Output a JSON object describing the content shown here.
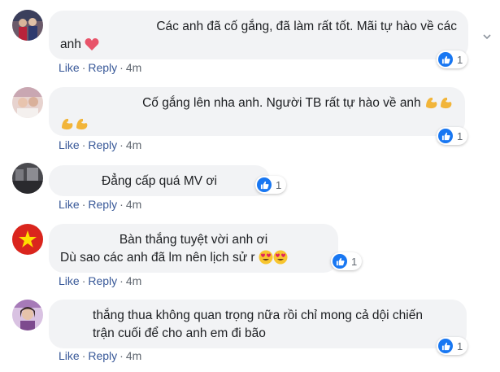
{
  "comments": [
    {
      "lines": [
        "Các anh đã cố gắng, đã làm rất tốt. Mãi tự hào về các",
        "anh"
      ],
      "actions": {
        "like": "Like",
        "reply": "Reply",
        "time": "4m"
      },
      "reaction_count": "1"
    },
    {
      "lines": [
        "Cố gắng lên nha anh. Người TB rất tự hào về anh",
        ""
      ],
      "actions": {
        "like": "Like",
        "reply": "Reply",
        "time": "4m"
      },
      "reaction_count": "1"
    },
    {
      "lines": [
        "Đẳng cấp quá MV ơi"
      ],
      "actions": {
        "like": "Like",
        "reply": "Reply",
        "time": "4m"
      },
      "reaction_count": "1"
    },
    {
      "lines": [
        "Bàn thắng tuyệt vời anh ơi",
        "Dù sao các anh đã lm nên lịch sử r"
      ],
      "actions": {
        "like": "Like",
        "reply": "Reply",
        "time": "4m"
      },
      "reaction_count": "1"
    },
    {
      "lines": [
        "thắng thua không quan trọng nữa rồi chỉ mong cả dội chiến",
        "trận cuối để cho anh em đi bão"
      ],
      "actions": {
        "like": "Like",
        "reply": "Reply",
        "time": "4m"
      },
      "reaction_count": "1"
    }
  ],
  "icons": {
    "like": "thumbs-up-icon",
    "heart": "red-heart-icon",
    "muscle": "flexed-biceps-icon",
    "heart_eyes": "heart-eyes-emoji-icon"
  },
  "colors": {
    "bubble": "#f2f3f5",
    "link": "#385898",
    "like_blue": "#1877f2"
  }
}
